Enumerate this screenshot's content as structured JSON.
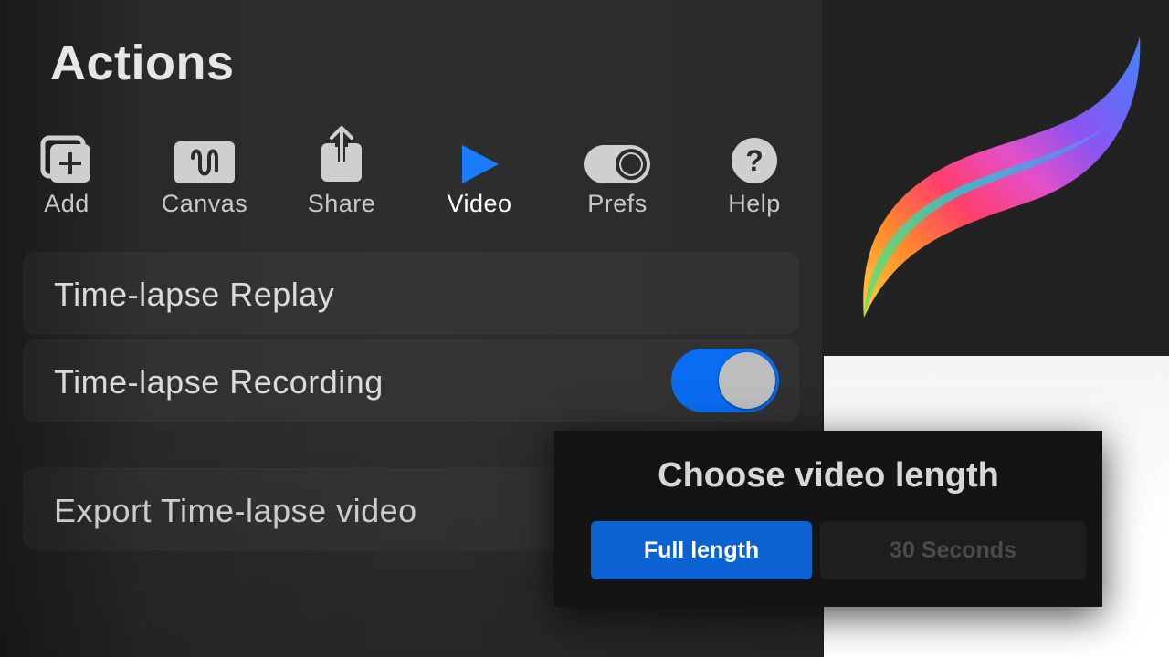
{
  "actions_panel": {
    "title": "Actions",
    "tabs": [
      {
        "label": "Add",
        "icon": "add-icon",
        "active": false
      },
      {
        "label": "Canvas",
        "icon": "canvas-icon",
        "active": false
      },
      {
        "label": "Share",
        "icon": "share-icon",
        "active": false
      },
      {
        "label": "Video",
        "icon": "play-icon",
        "active": true
      },
      {
        "label": "Prefs",
        "icon": "toggle-icon",
        "active": false
      },
      {
        "label": "Help",
        "icon": "help-icon",
        "active": false
      }
    ],
    "items": [
      {
        "label": "Time-lapse Replay"
      },
      {
        "label": "Time-lapse Recording",
        "toggle_on": true
      },
      {
        "label": "Export Time-lapse video"
      }
    ]
  },
  "dialog": {
    "title": "Choose video length",
    "options": [
      {
        "label": "Full length",
        "selected": true
      },
      {
        "label": "30 Seconds",
        "selected": false
      }
    ]
  },
  "colors": {
    "accent": "#0a6cf0",
    "active_tab": "#1a7cff",
    "panel_bg": "#2b2b2b",
    "dialog_bg": "#141414"
  },
  "logo": {
    "icon": "procreate-logo"
  }
}
